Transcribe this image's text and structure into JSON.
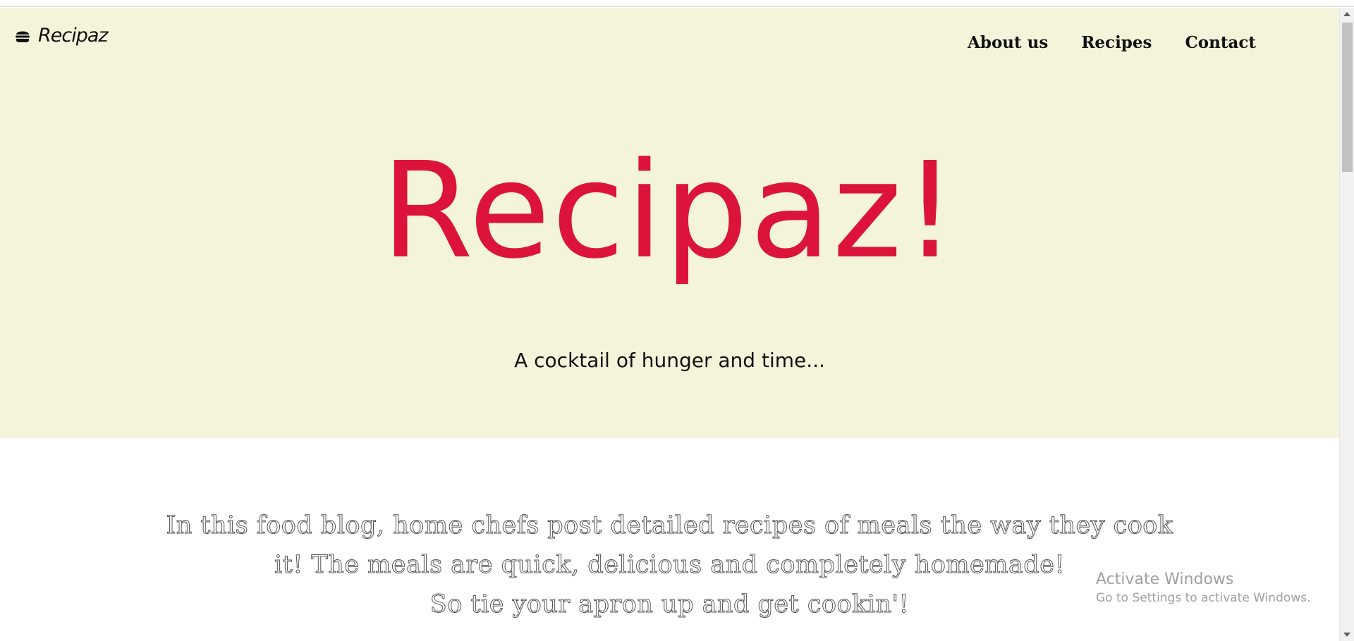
{
  "header": {
    "brand_label": "Recipaz",
    "brand_icon": "hamburger-icon",
    "nav": [
      {
        "label": "About us"
      },
      {
        "label": "Recipes"
      },
      {
        "label": "Contact"
      }
    ]
  },
  "hero": {
    "title": "Recipaz!",
    "tagline": "A cocktail of hunger and time...",
    "background": "#f4f4da",
    "title_color": "#dc143c"
  },
  "intro": {
    "lines": [
      "In this food blog, home chefs post detailed recipes of meals the way they cook",
      "it! The meals are quick, delicious and completely homemade!",
      "So tie your apron up and get cookin'!"
    ]
  },
  "watermark": {
    "title": "Activate Windows",
    "subtitle": "Go to Settings to activate Windows."
  }
}
